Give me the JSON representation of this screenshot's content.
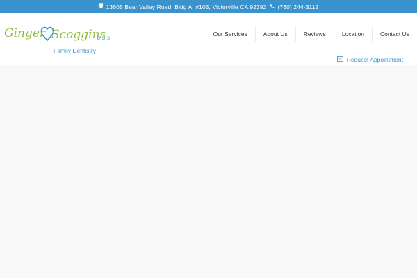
{
  "topbar": {
    "address": "13605 Bear Valley Road, Bldg A, #105, Victorville CA 92392",
    "phone": "(760) 244-3112"
  },
  "logo": {
    "first": "Ginger",
    "last": "Scoggins",
    "suffix": "D.D.S",
    "subtitle": "Family Dentistry"
  },
  "nav": {
    "items": [
      {
        "label": "Our Services"
      },
      {
        "label": "About Us"
      },
      {
        "label": "Reviews"
      },
      {
        "label": "Location"
      },
      {
        "label": "Contact Us"
      }
    ]
  },
  "cta": {
    "request_label": "Request Appointment"
  },
  "colors": {
    "brand_blue": "#3a93cd",
    "brand_green": "#8fbe3f"
  }
}
